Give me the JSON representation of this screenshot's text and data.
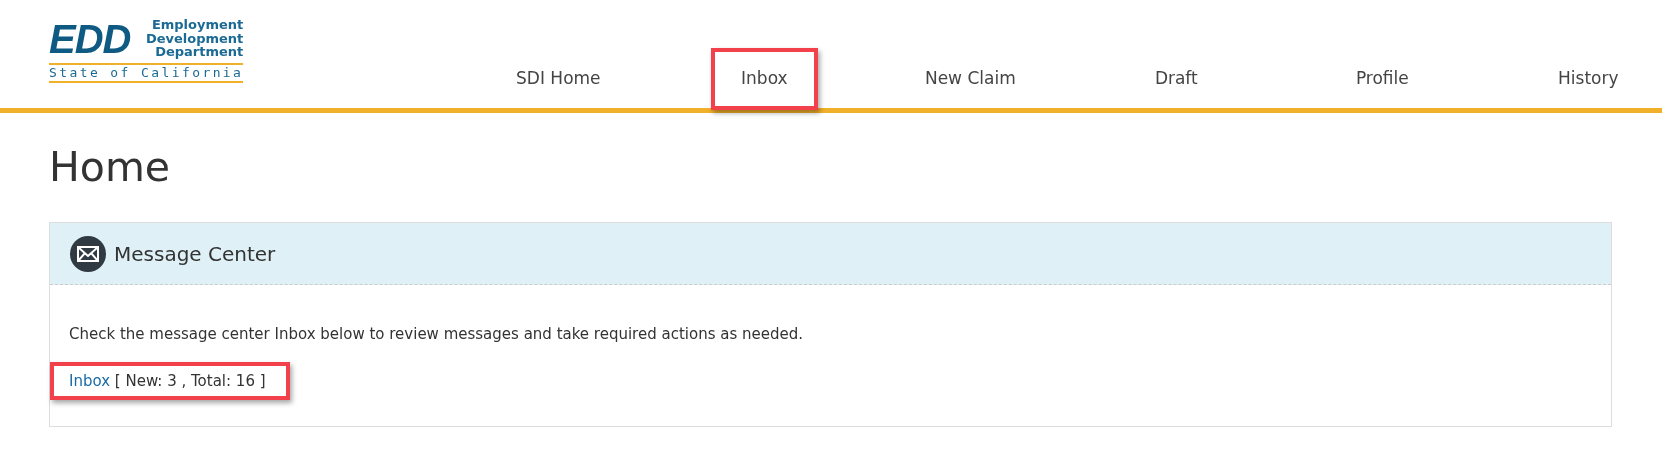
{
  "logo": {
    "mark": "EDD",
    "lines": [
      "Employment",
      "Development",
      "Department"
    ],
    "state": "State of California"
  },
  "nav": [
    {
      "label": "SDI Home",
      "highlighted": false
    },
    {
      "label": "Inbox",
      "highlighted": true
    },
    {
      "label": "New Claim",
      "highlighted": false
    },
    {
      "label": "Draft",
      "highlighted": false
    },
    {
      "label": "Profile",
      "highlighted": false
    },
    {
      "label": "History",
      "highlighted": false
    }
  ],
  "page_title": "Home",
  "panel": {
    "title": "Message Center",
    "description": "Check the message center Inbox below to review messages and take required actions as needed.",
    "inbox": {
      "link": "Inbox",
      "counts": "[ New: 3 , Total: 16 ]",
      "highlighted": true
    }
  }
}
